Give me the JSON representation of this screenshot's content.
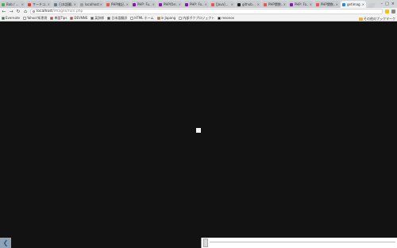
{
  "window": {
    "controls": [
      "–",
      "□",
      "×"
    ]
  },
  "tabs": [
    {
      "title": "Bab / ...",
      "active": false,
      "color": "#4caf50"
    },
    {
      "title": "サーチコ...",
      "active": false,
      "color": "#e53935"
    },
    {
      "title": "日本語翻...",
      "active": false,
      "color": "#607d8b"
    },
    {
      "title": "localhost",
      "active": false,
      "color": "#9e9e9e"
    },
    {
      "title": "PHP雑記...",
      "active": false,
      "color": "#ef5350"
    },
    {
      "title": "PHP: Fu...",
      "active": false,
      "color": "#7b1fa2"
    },
    {
      "title": "PHP/Oe:...",
      "active": false,
      "color": "#7b1fa2"
    },
    {
      "title": "PHP: Fo...",
      "active": false,
      "color": "#7b1fa2"
    },
    {
      "title": "[Java]...",
      "active": false,
      "color": "#ef5350"
    },
    {
      "title": "github...",
      "active": false,
      "color": "#212121"
    },
    {
      "title": "PHP関数...",
      "active": false,
      "color": "#ef5350"
    },
    {
      "title": "PHP: Fo...",
      "active": false,
      "color": "#7b1fa2"
    },
    {
      "title": "PHP関数...",
      "active": false,
      "color": "#ef5350"
    },
    {
      "title": "getimag...",
      "active": true,
      "color": "#1e88e5"
    }
  ],
  "toolbar": {
    "back": "←",
    "forward": "→",
    "reload": "↻",
    "home": "⌂",
    "url_host": "localhost",
    "url_path": "/images/ruin.php"
  },
  "bookmarks": [
    {
      "label": "Evernote",
      "color": "#2e7d32"
    },
    {
      "label": "Yahoo!知恵袋",
      "color": "#ffffff"
    },
    {
      "label": "単語Tips",
      "color": "#e53935"
    },
    {
      "label": "DEVNNS",
      "color": "#e53935"
    },
    {
      "label": "英辞郎",
      "color": "#555555"
    },
    {
      "label": "日本語翻訳",
      "color": "#555555"
    },
    {
      "label": "HTML ホーム",
      "color": "#ffffff"
    },
    {
      "label": "in Japang",
      "color": "#ef6c00"
    },
    {
      "label": "内部ボクプロジェクト",
      "color": "#ffffff"
    },
    {
      "label": "resonox",
      "color": "#212121"
    }
  ],
  "bookmarks_folder": "その他のブックマーク"
}
